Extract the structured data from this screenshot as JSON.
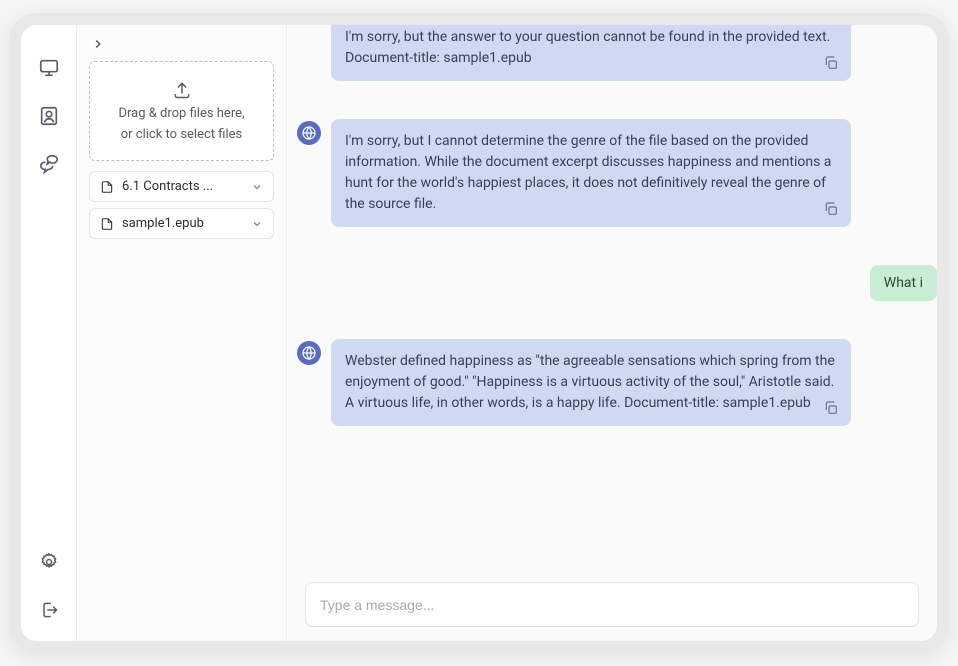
{
  "iconbar": {
    "items": [
      "monitor",
      "user",
      "chat",
      "settings",
      "logout"
    ]
  },
  "dropzone": {
    "line1": "Drag & drop files here,",
    "line2": "or click to select files"
  },
  "files": [
    {
      "name": "6.1 Contracts ..."
    },
    {
      "name": "sample1.epub"
    }
  ],
  "messages": [
    {
      "role": "assistant",
      "text": "I'm sorry, but the answer to your question cannot be found in the provided text. Document-title: sample1.epub"
    },
    {
      "role": "assistant",
      "text": "I'm sorry, but I cannot determine the genre of the file based on the provided information. While the document excerpt discusses happiness and mentions a hunt for the world's happiest places, it does not definitively reveal the genre of the source file."
    },
    {
      "role": "user",
      "text": "What i"
    },
    {
      "role": "assistant",
      "text": "Webster defined happiness as \"the agreeable sensations which spring from the enjoyment of good.\" \"Happiness is a virtuous activity of the soul,\" Aristotle said. A virtuous life, in other words, is a happy life. Document-title: sample1.epub"
    }
  ],
  "input": {
    "placeholder": "Type a message..."
  }
}
